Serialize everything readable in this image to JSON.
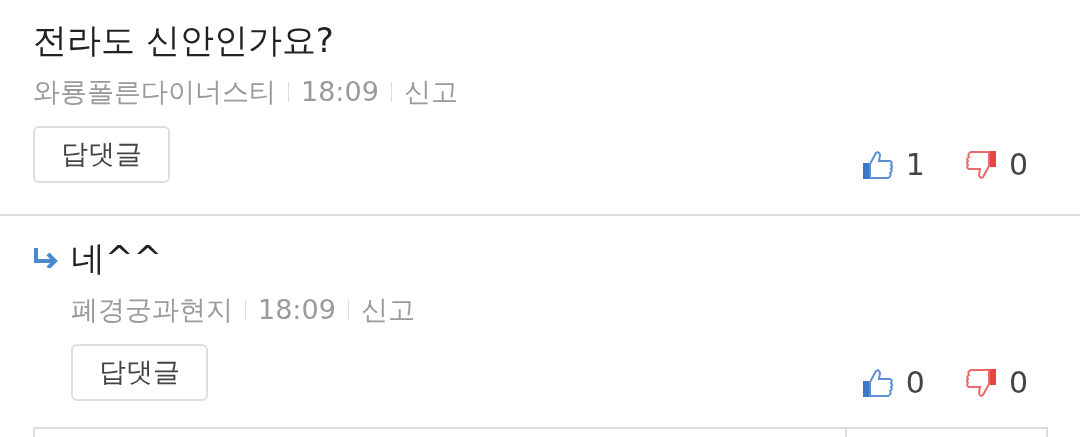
{
  "comments": [
    {
      "kind": "comment",
      "text": "전라도 신안인가요?",
      "author": "와룡폴른다이너스티",
      "time": "18:09",
      "report": "신고",
      "reply_button": "답댓글",
      "likes": "1",
      "dislikes": "0"
    },
    {
      "kind": "reply",
      "text": "네^^",
      "author": "폐경궁과현지",
      "time": "18:09",
      "report": "신고",
      "reply_button": "답댓글",
      "likes": "0",
      "dislikes": "0"
    }
  ]
}
